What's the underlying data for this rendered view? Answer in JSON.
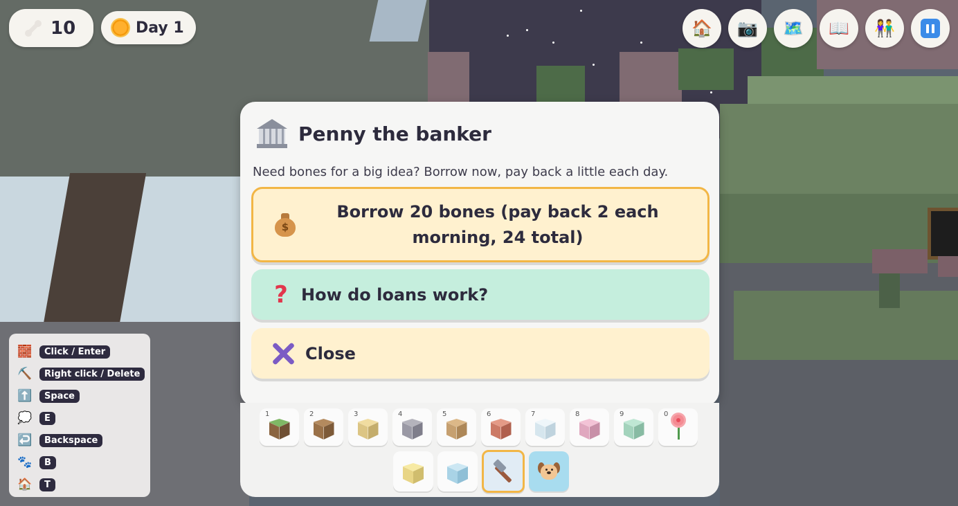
{
  "hud": {
    "bones": "10",
    "day": "Day 1",
    "buttons": [
      {
        "name": "home-button",
        "icon": "house-icon",
        "glyph": "🏠"
      },
      {
        "name": "camera-button",
        "icon": "camera-icon",
        "glyph": "📷"
      },
      {
        "name": "map-button",
        "icon": "map-icon",
        "glyph": "🗺️"
      },
      {
        "name": "book-button",
        "icon": "book-icon",
        "glyph": "📖"
      },
      {
        "name": "people-button",
        "icon": "people-icon",
        "glyph": "👫"
      },
      {
        "name": "pause-button",
        "icon": "pause-icon",
        "glyph": ""
      }
    ]
  },
  "controls": [
    {
      "icon": "brick-icon",
      "glyph": "🧱",
      "key": "Click / Enter"
    },
    {
      "icon": "pickaxe-icon",
      "glyph": "⛏️",
      "key": "Right click / Delete"
    },
    {
      "icon": "up-arrow-icon",
      "glyph": "⬆️",
      "key": "Space"
    },
    {
      "icon": "speech-bubble-icon",
      "glyph": "💭",
      "key": "E"
    },
    {
      "icon": "return-arrow-icon",
      "glyph": "↩️",
      "key": "Backspace"
    },
    {
      "icon": "paw-icon",
      "glyph": "🐾",
      "key": "B"
    },
    {
      "icon": "house-icon",
      "glyph": "🏠",
      "key": "T"
    }
  ],
  "dialog": {
    "title": "Penny the banker",
    "text": "Need bones for a big idea? Borrow now, pay back a little each day.",
    "options": {
      "borrow": "Borrow 20 bones (pay back 2 each morning, 24 total)",
      "how": "How do loans work?",
      "close": "Close"
    }
  },
  "hotbar": {
    "slots": [
      {
        "num": "1",
        "top": "#7fb865",
        "left": "#8a6440",
        "right": "#6f5034"
      },
      {
        "num": "2",
        "top": "#b48a5e",
        "left": "#9a7148",
        "right": "#7d5a38"
      },
      {
        "num": "3",
        "top": "#f0dca0",
        "left": "#dcc584",
        "right": "#c4ad6c"
      },
      {
        "num": "4",
        "top": "#b4b3bc",
        "left": "#9a99a5",
        "right": "#7f7e8b"
      },
      {
        "num": "5",
        "top": "#dcb888",
        "left": "#c6a070",
        "right": "#ad8758"
      },
      {
        "num": "6",
        "top": "#e49a86",
        "left": "#cc7a66",
        "right": "#b0604e"
      },
      {
        "num": "7",
        "top": "#eef6fa",
        "left": "#d6e6ee",
        "right": "#bfd3de"
      },
      {
        "num": "8",
        "top": "#f3c3d6",
        "left": "#e0a8bf",
        "right": "#c890a8"
      },
      {
        "num": "9",
        "top": "#bfe7d4",
        "left": "#a3d3bc",
        "right": "#88bba3"
      },
      {
        "num": "0",
        "flower": true
      }
    ],
    "tools": [
      {
        "name": "sand-block-tool",
        "top": "#f7eaa4",
        "left": "#e8d586",
        "right": "#d0bd6e"
      },
      {
        "name": "ice-block-tool",
        "top": "#cce7f3",
        "left": "#a9d3e6",
        "right": "#8fbfd6"
      },
      {
        "name": "hammer-tool",
        "icon": "hammer-icon"
      },
      {
        "name": "dog-tool",
        "icon": "dog-icon"
      }
    ]
  }
}
